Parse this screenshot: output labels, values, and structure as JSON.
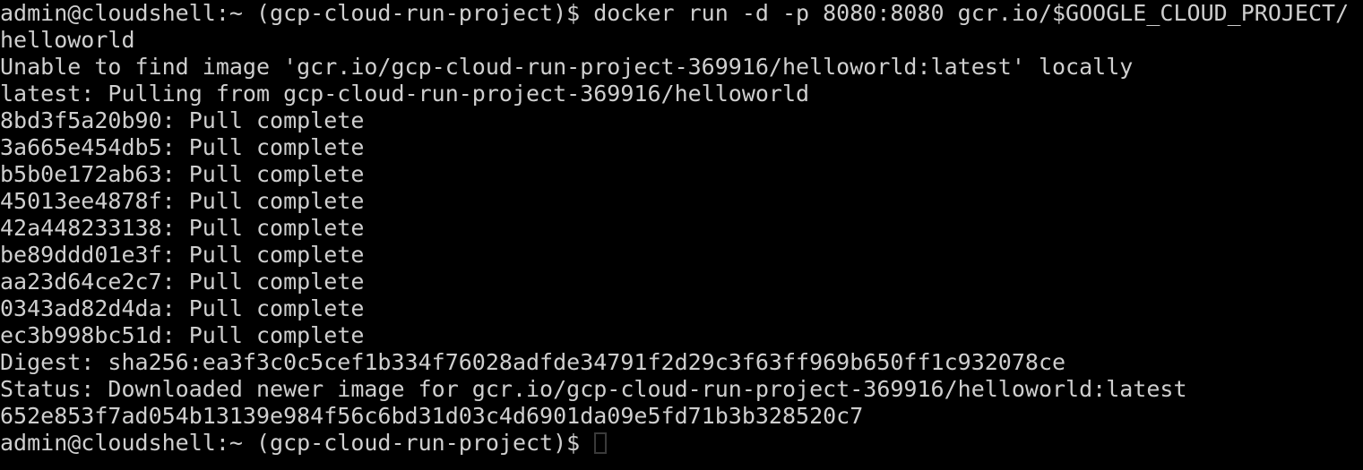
{
  "terminal": {
    "background_color": "#000000",
    "text_color": "#cfcfcf",
    "cursor_color": "#3a3a3a",
    "prompt": "admin@cloudshell:~ (gcp-cloud-run-project)$ ",
    "lines": [
      "admin@cloudshell:~ (gcp-cloud-run-project)$ docker run -d -p 8080:8080 gcr.io/$GOOGLE_CLOUD_PROJECT/",
      "helloworld",
      "Unable to find image 'gcr.io/gcp-cloud-run-project-369916/helloworld:latest' locally",
      "latest: Pulling from gcp-cloud-run-project-369916/helloworld",
      "8bd3f5a20b90: Pull complete",
      "3a665e454db5: Pull complete",
      "b5b0e172ab63: Pull complete",
      "45013ee4878f: Pull complete",
      "42a448233138: Pull complete",
      "be89ddd01e3f: Pull complete",
      "aa23d64ce2c7: Pull complete",
      "0343ad82d4da: Pull complete",
      "ec3b998bc51d: Pull complete",
      "Digest: sha256:ea3f3c0c5cef1b334f76028adfde34791f2d29c3f63ff969b650ff1c932078ce",
      "Status: Downloaded newer image for gcr.io/gcp-cloud-run-project-369916/helloworld:latest",
      "652e853f7ad054b13139e984f56c6bd31d03c4d6901da09e5fd71b3b328520c7"
    ],
    "final_prompt": "admin@cloudshell:~ (gcp-cloud-run-project)$ ",
    "command": "docker run -d -p 8080:8080 gcr.io/$GOOGLE_CLOUD_PROJECT/helloworld",
    "image_reference": "gcr.io/gcp-cloud-run-project-369916/helloworld:latest",
    "project_id": "gcp-cloud-run-project-369916",
    "digest": "sha256:ea3f3c0c5cef1b334f76028adfde34791f2d29c3f63ff969b650ff1c932078ce",
    "container_id": "652e853f7ad054b13139e984f56c6bd31d03c4d6901da09e5fd71b3b328520c7",
    "port_mapping": "8080:8080",
    "layers": [
      {
        "id": "8bd3f5a20b90",
        "status": "Pull complete"
      },
      {
        "id": "3a665e454db5",
        "status": "Pull complete"
      },
      {
        "id": "b5b0e172ab63",
        "status": "Pull complete"
      },
      {
        "id": "45013ee4878f",
        "status": "Pull complete"
      },
      {
        "id": "42a448233138",
        "status": "Pull complete"
      },
      {
        "id": "be89ddd01e3f",
        "status": "Pull complete"
      },
      {
        "id": "aa23d64ce2c7",
        "status": "Pull complete"
      },
      {
        "id": "0343ad82d4da",
        "status": "Pull complete"
      },
      {
        "id": "ec3b998bc51d",
        "status": "Pull complete"
      }
    ]
  }
}
